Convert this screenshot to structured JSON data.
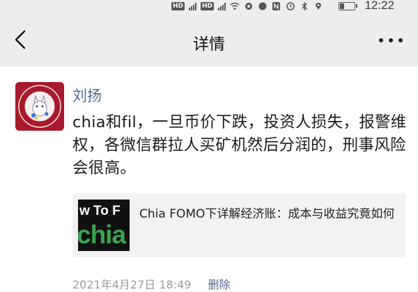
{
  "status_bar": {
    "time": "12:22",
    "badges": [
      "HD",
      "HD"
    ],
    "icons": [
      "signal-icon",
      "wifi-icon",
      "hotspot-icon",
      "nfc-icon",
      "alarm-icon",
      "bluetooth-icon",
      "location-icon",
      "battery-icon"
    ]
  },
  "nav": {
    "title": "详情",
    "back_icon": "chevron-left-icon",
    "more_icon": "more-dots-icon"
  },
  "post": {
    "author": "刘扬",
    "text": "chia和fil，一旦币价下跌，投资人损失，报警维权，各微信群拉人买矿机然后分润的，刑事风险会很高。",
    "link_card": {
      "thumb_top_text": "w To F",
      "thumb_brand_text": "chia",
      "title": "Chia FOMO下详解经济账：成本与收益究竟如何"
    },
    "timestamp": "2021年4月27日 18:49",
    "delete_label": "删除"
  },
  "colors": {
    "nav_bg": "#ededed",
    "author_link": "#576b95",
    "card_bg": "#f2f2f2",
    "avatar_red": "#a8192b",
    "chia_green": "#3aa54d"
  }
}
